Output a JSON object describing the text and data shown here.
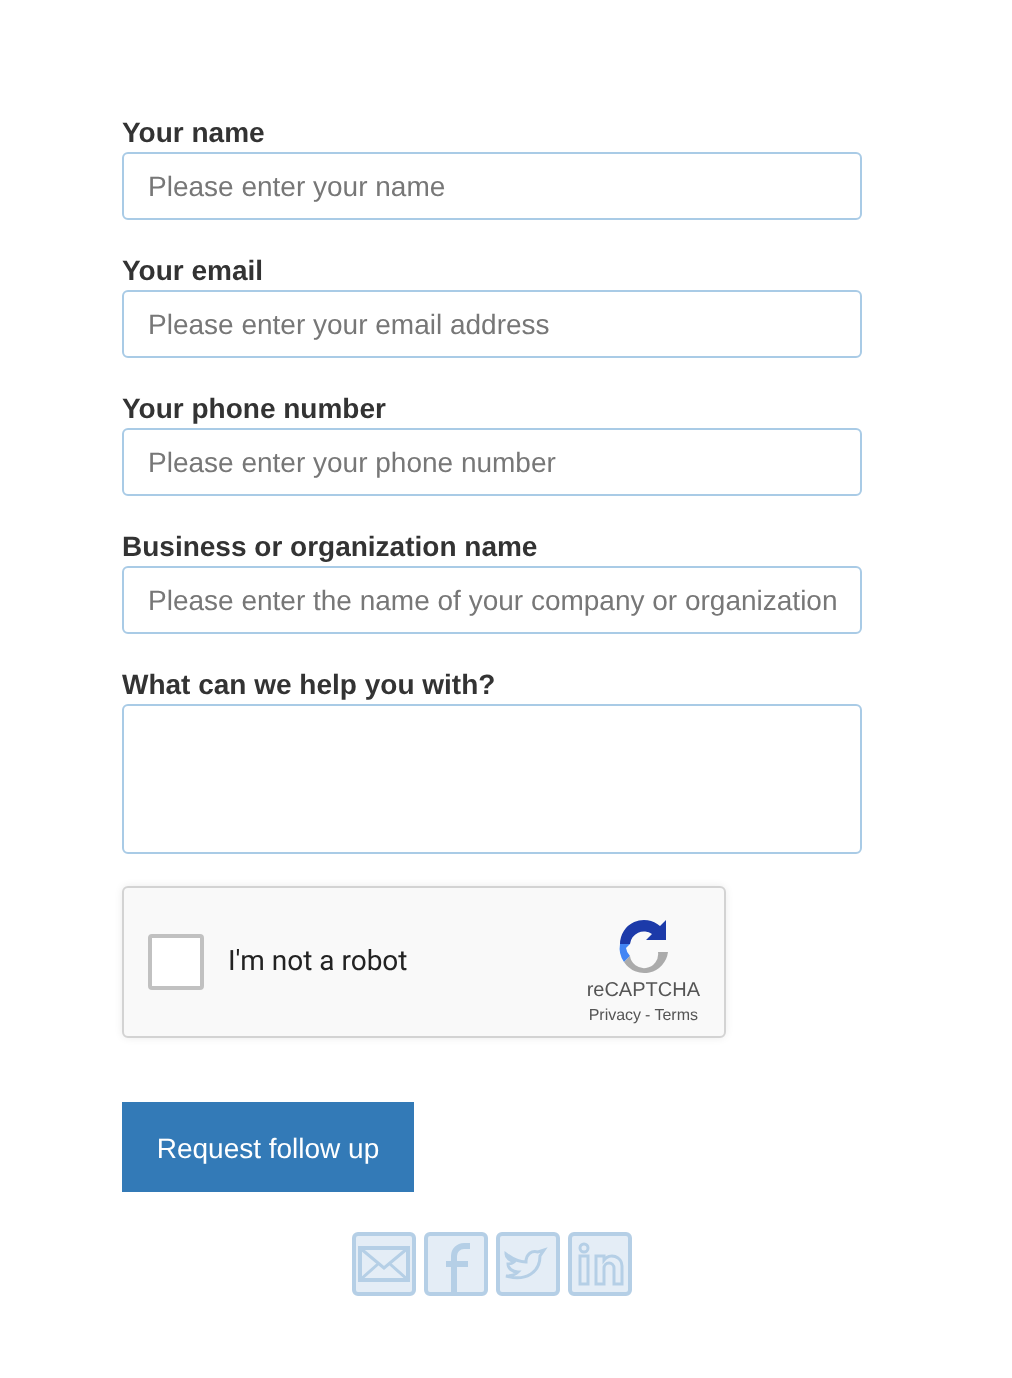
{
  "fields": [
    {
      "kind": "input",
      "label": "Your name",
      "placeholder": "Please enter your name"
    },
    {
      "kind": "input",
      "label": "Your email",
      "placeholder": "Please enter your email address"
    },
    {
      "kind": "input",
      "label": "Your phone number",
      "placeholder": "Please enter your phone number"
    },
    {
      "kind": "input",
      "label": "Business or organization name",
      "placeholder": "Please enter the name of your company or organization"
    },
    {
      "kind": "textarea",
      "label": "What can we help you with?"
    }
  ],
  "captcha": {
    "label": "I'm not a robot",
    "checked": false,
    "brand": "reCAPTCHA",
    "privacy": "Privacy",
    "separator": "-",
    "terms": "Terms"
  },
  "submit": "Request follow up"
}
